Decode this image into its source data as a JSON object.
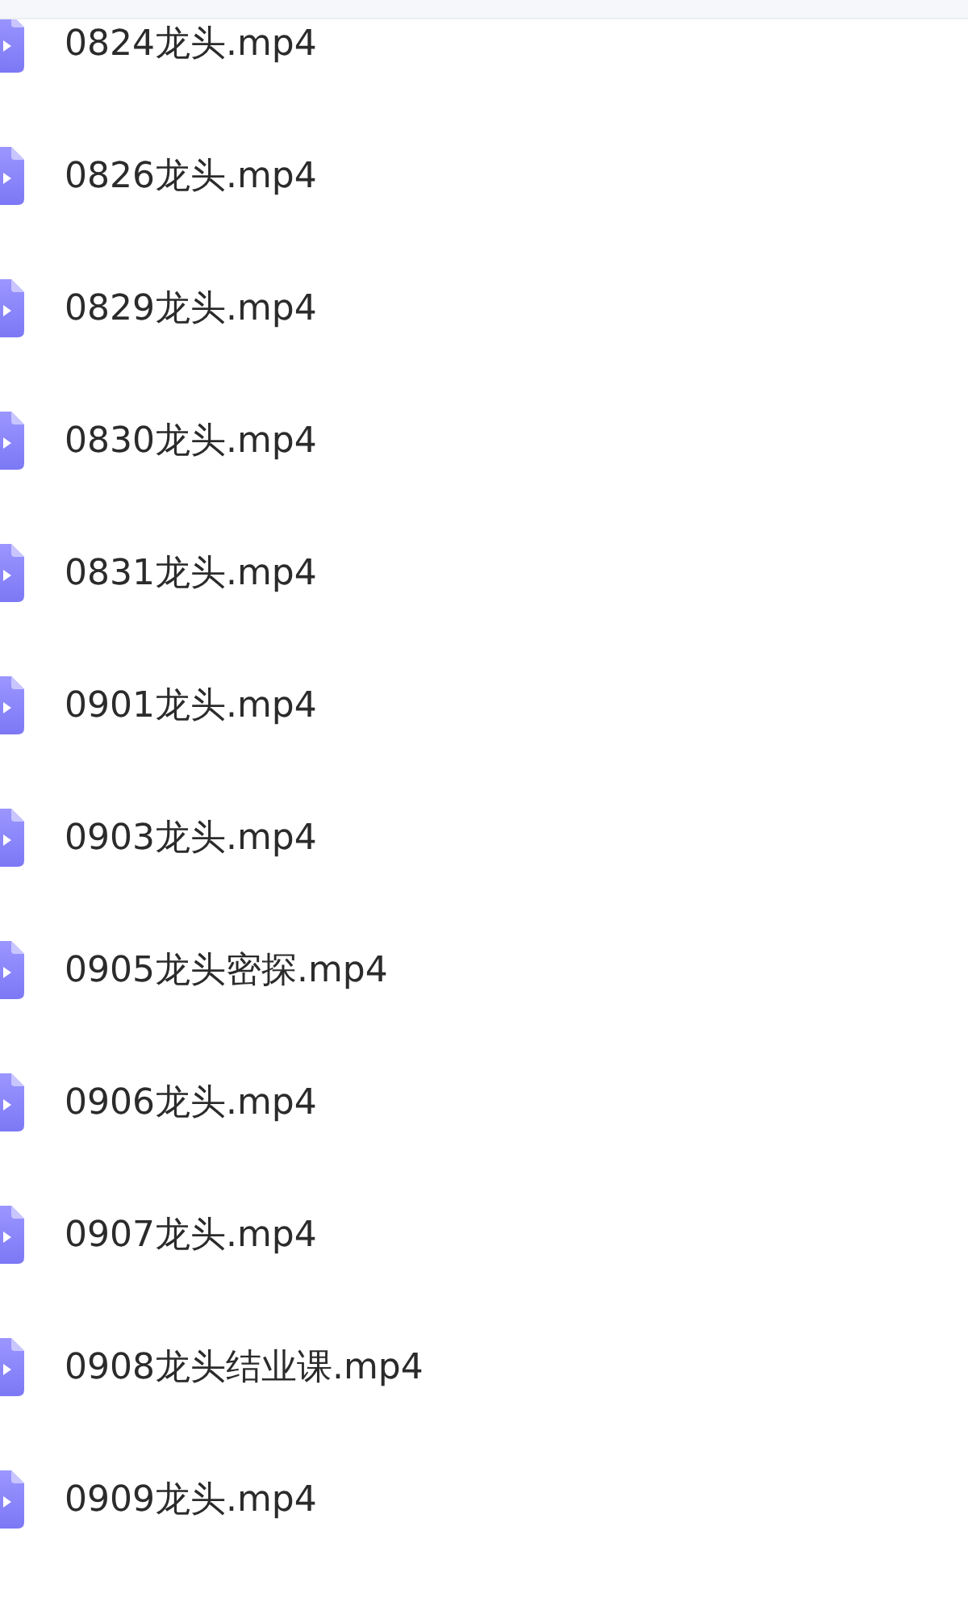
{
  "files": [
    {
      "name": "0824龙头.mp4"
    },
    {
      "name": "0826龙头.mp4"
    },
    {
      "name": "0829龙头.mp4"
    },
    {
      "name": "0830龙头.mp4"
    },
    {
      "name": "0831龙头.mp4"
    },
    {
      "name": "0901龙头.mp4"
    },
    {
      "name": "0903龙头.mp4"
    },
    {
      "name": "0905龙头密探.mp4"
    },
    {
      "name": "0906龙头.mp4"
    },
    {
      "name": "0907龙头.mp4"
    },
    {
      "name": "0908龙头结业课.mp4"
    },
    {
      "name": "0909龙头.mp4"
    }
  ]
}
